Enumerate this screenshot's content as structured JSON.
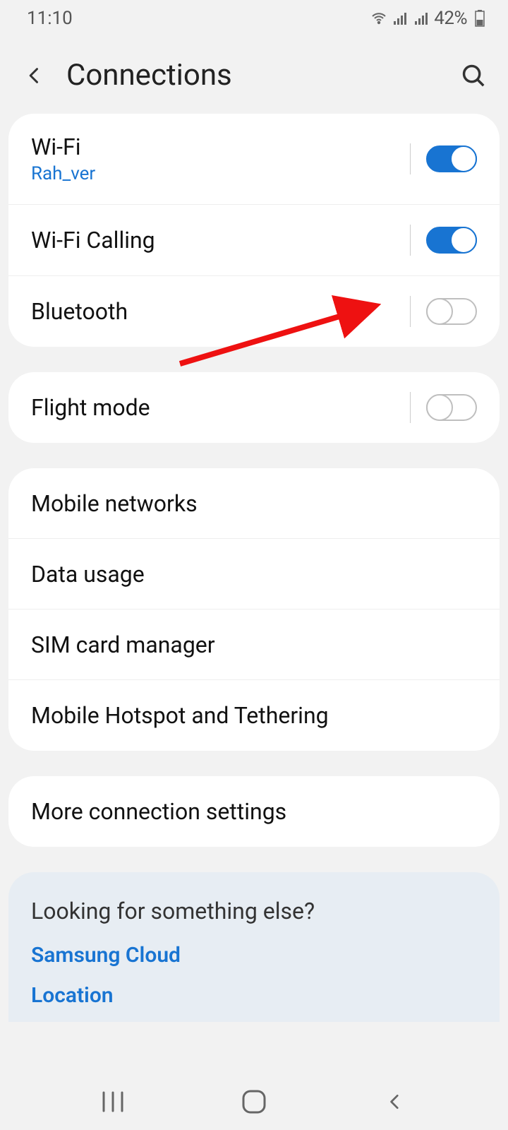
{
  "status": {
    "time": "11:10",
    "battery": "42%"
  },
  "header": {
    "title": "Connections"
  },
  "group1": {
    "wifi": {
      "title": "Wi-Fi",
      "sub": "Rah_ver",
      "on": true
    },
    "wificall": {
      "title": "Wi-Fi Calling",
      "on": true
    },
    "bluetooth": {
      "title": "Bluetooth",
      "on": false
    }
  },
  "group2": {
    "flight": {
      "title": "Flight mode",
      "on": false
    }
  },
  "group3": {
    "mobile": "Mobile networks",
    "data": "Data usage",
    "sim": "SIM card manager",
    "hotspot": "Mobile Hotspot and Tethering"
  },
  "group4": {
    "more": "More connection settings"
  },
  "tips": {
    "title": "Looking for something else?",
    "link1": "Samsung Cloud",
    "link2": "Location"
  }
}
